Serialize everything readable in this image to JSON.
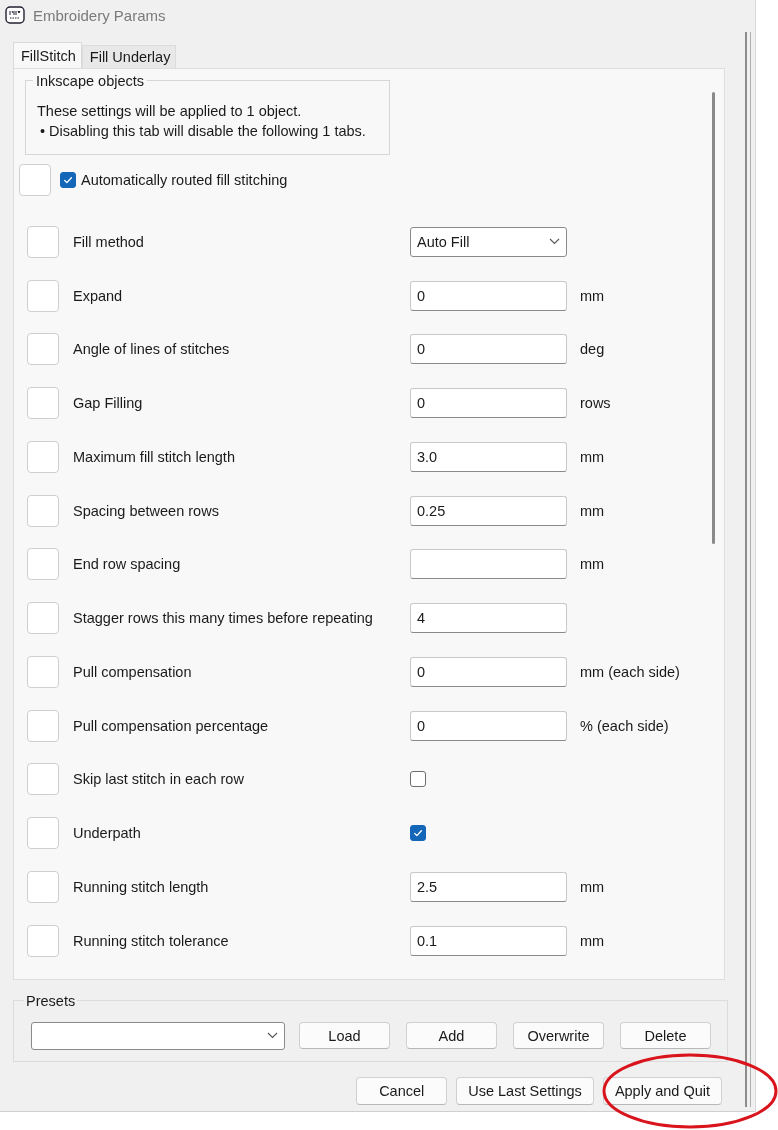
{
  "window": {
    "title": "Embroidery Params"
  },
  "tabs": [
    {
      "label": "FillStitch",
      "selected": true
    },
    {
      "label": "Fill Underlay",
      "selected": false
    }
  ],
  "info_group": {
    "title": "Inkscape objects",
    "lines": [
      "These settings will be applied to 1 object.",
      "• Disabling this tab will disable the following 1 tabs."
    ]
  },
  "toggle": {
    "label": "Automatically routed fill stitching",
    "checked": true
  },
  "params": [
    {
      "kind": "dropdown",
      "label": "Fill method",
      "value": "Auto Fill"
    },
    {
      "kind": "text",
      "label": "Expand",
      "value": "0",
      "unit": "mm"
    },
    {
      "kind": "text",
      "label": "Angle of lines of stitches",
      "value": "0",
      "unit": "deg"
    },
    {
      "kind": "text",
      "label": "Gap Filling",
      "value": "0",
      "unit": "rows"
    },
    {
      "kind": "text",
      "label": "Maximum fill stitch length",
      "value": "3.0",
      "unit": "mm"
    },
    {
      "kind": "text",
      "label": "Spacing between rows",
      "value": "0.25",
      "unit": "mm"
    },
    {
      "kind": "text",
      "label": "End row spacing",
      "unit": "mm"
    },
    {
      "kind": "text",
      "label": "Stagger rows this many times before repeating",
      "value": "4"
    },
    {
      "kind": "text",
      "label": "Pull compensation",
      "value": "0",
      "unit": "mm (each side)"
    },
    {
      "kind": "text",
      "label": "Pull compensation percentage",
      "value": "0",
      "unit": "% (each side)"
    },
    {
      "kind": "checkbox",
      "label": "Skip last stitch in each row",
      "checked": false
    },
    {
      "kind": "checkbox",
      "label": "Underpath",
      "checked": true
    },
    {
      "kind": "text",
      "label": "Running stitch length",
      "value": "2.5",
      "unit": "mm"
    },
    {
      "kind": "text",
      "label": "Running stitch tolerance",
      "value": "0.1",
      "unit": "mm"
    }
  ],
  "presets": {
    "title": "Presets",
    "buttons": [
      "Load",
      "Add",
      "Overwrite",
      "Delete"
    ]
  },
  "buttons": [
    "Cancel",
    "Use Last Settings",
    "Apply and Quit"
  ],
  "annotation": {
    "kind": "ellipse"
  }
}
